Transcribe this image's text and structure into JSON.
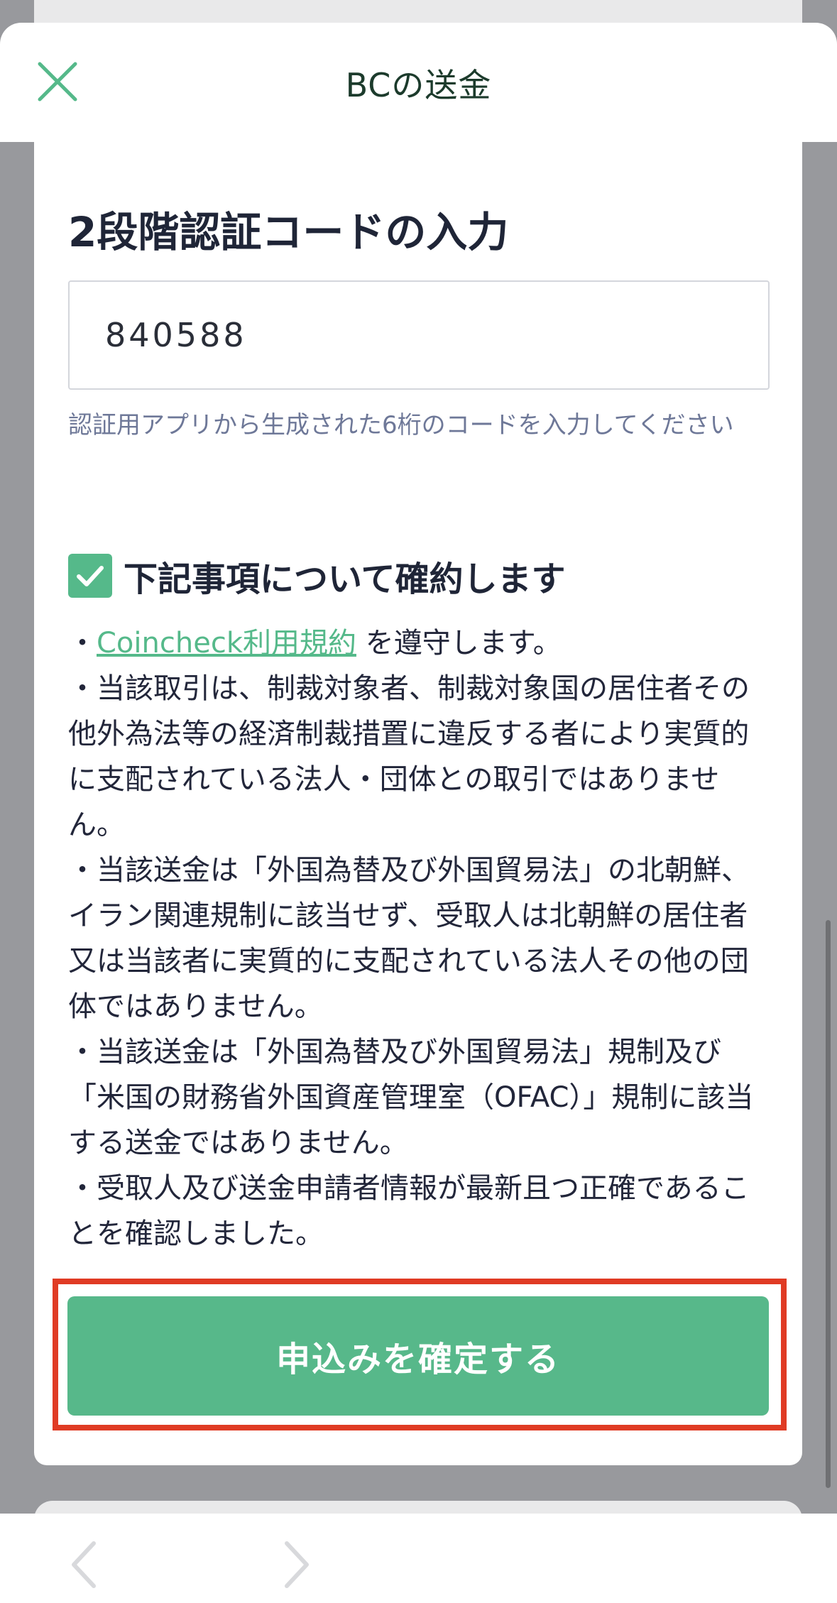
{
  "header": {
    "title": "BCの送金",
    "close_icon": "close-icon",
    "accent_color": "#55b98a"
  },
  "two_factor": {
    "title": "2段階認証コードの入力",
    "code_value": "840588",
    "hint": "認証用アプリから生成された6桁のコードを入力してください"
  },
  "agreement": {
    "checked": true,
    "label": "下記事項について確約します",
    "bullet": "・",
    "terms_link": "Coincheck利用規約",
    "terms_suffix": " を遵守します。",
    "items": [
      "・当該取引は、制裁対象者、制裁対象国の居住者その他外為法等の経済制裁措置に違反する者により実質的に支配されている法人・団体との取引ではありません。",
      "・当該送金は「外国為替及び外国貿易法」の北朝鮮、イラン関連規制に該当せず、受取人は北朝鮮の居住者又は当該者に実質的に支配されている法人その他の団体ではありません。",
      "・当該送金は「外国為替及び外国貿易法」規制及び「米国の財務省外国資産管理室（OFAC）」規制に該当する送金ではありません。",
      "・受取人及び送金申請者情報が最新且つ正確であることを確認しました。"
    ]
  },
  "confirm_button": {
    "label": "申込みを確定する",
    "color": "#57b88a",
    "highlight_color": "#e03b24"
  },
  "bottom_nav": {
    "back_icon": "chevron-left-icon",
    "forward_icon": "chevron-right-icon"
  }
}
